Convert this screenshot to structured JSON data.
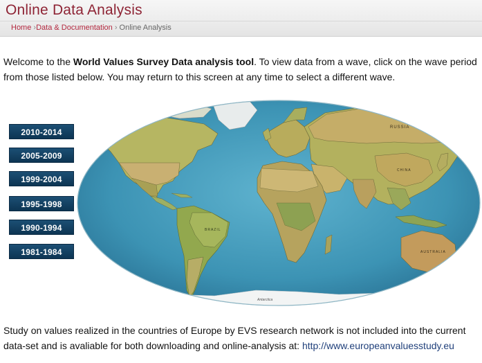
{
  "header": {
    "title": "Online Data Analysis",
    "breadcrumb": {
      "home": "Home",
      "sep1": "›",
      "section": "Data & Documentation",
      "sep2": "›",
      "current": "Online Analysis"
    }
  },
  "intro": {
    "before": "Welcome to the ",
    "bold": "World Values Survey Data analysis tool",
    "after": ". To view data from a wave, click on the wave period from those listed below. You may return to this screen at any time to select a different wave."
  },
  "waves": [
    "2010-2014",
    "2005-2009",
    "1999-2004",
    "1995-1998",
    "1990-1994",
    "1981-1984"
  ],
  "map": {
    "labels": {
      "russia": "RUSSIA",
      "china": "CHINA",
      "brazil": "BRAZIL",
      "australia": "AUSTRALIA",
      "antarctica": "Antarctica"
    }
  },
  "footer": {
    "text": "Study on values realized in the countries of Europe by EVS research network is not included into the current data-set and is avaliable for both downloading and online-analysis at: ",
    "link": "http://www.europeanvaluesstudy.eu"
  },
  "colors": {
    "title": "#8e2435",
    "breadcrumb_link": "#b3283f",
    "button_bg": "#0d3553",
    "ocean": "#3f98b8",
    "land": "#a7a95a"
  }
}
